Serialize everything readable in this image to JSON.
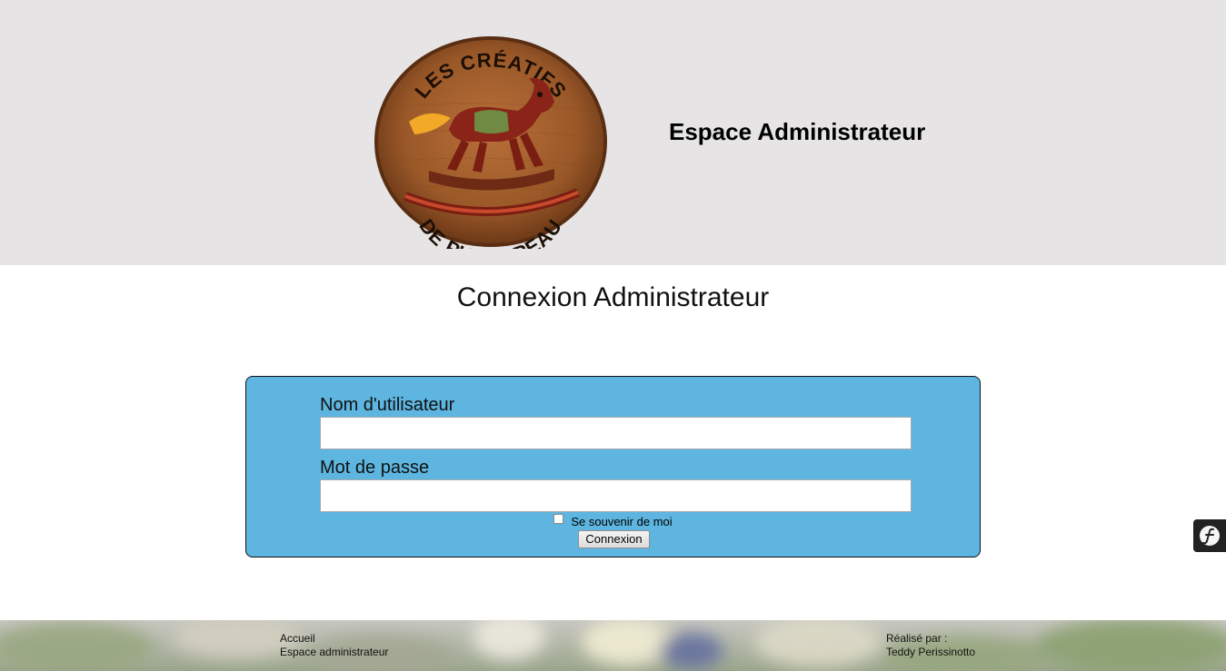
{
  "header": {
    "logo": {
      "top_text": "LES CRÉATIFS",
      "bottom_text": "DE PUYGAREAU"
    },
    "title": "Espace Administrateur"
  },
  "main": {
    "title": "Connexion Administrateur",
    "form": {
      "username_label": "Nom d'utilisateur",
      "username_value": "",
      "password_label": "Mot de passe",
      "password_value": "",
      "remember_label": "Se souvenir de moi",
      "remember_checked": false,
      "submit_label": "Connexion"
    }
  },
  "footer": {
    "links": [
      "Accueil",
      "Espace administrateur"
    ],
    "credit_label": "Réalisé par :",
    "credit_name": "Teddy Perissinotto"
  },
  "colors": {
    "header_bg": "#e6e4e5",
    "form_bg": "#5db5e0",
    "toolbar_bg": "#222222"
  },
  "icons": {
    "toolbar_toggle": "symfony-icon"
  }
}
